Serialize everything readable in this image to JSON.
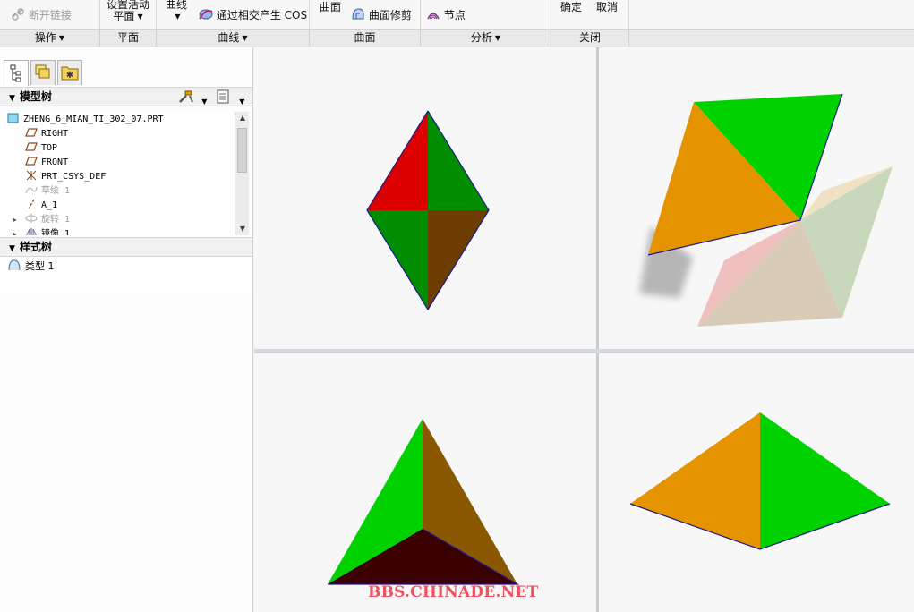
{
  "ribbon": {
    "groups": [
      {
        "label": "操作",
        "has_menu": true
      },
      {
        "label": "平面",
        "has_menu": false
      },
      {
        "label": "曲线",
        "has_menu": true
      },
      {
        "label": "曲面",
        "has_menu": false
      },
      {
        "label": "分析",
        "has_menu": true
      },
      {
        "label": "关闭",
        "has_menu": false
      }
    ],
    "disconnect_link": "断开链接",
    "set_active_plane_line1": "设置活动",
    "set_active_plane_line2": "平面",
    "curve": "曲线",
    "intersect_cos": "通过相交产生 COS",
    "surface": "曲面",
    "surface_trim": "曲面修剪",
    "node": "节点",
    "ok": "确定",
    "cancel": "取消"
  },
  "left_panel": {
    "model_tree_title": "模型树",
    "style_tree_title": "样式树",
    "model_tree_items": [
      {
        "label": "ZHENG_6_MIAN_TI_302_07.PRT",
        "icon": "part-icon",
        "dim": false,
        "expandable": false
      },
      {
        "label": "RIGHT",
        "icon": "datum-plane-icon",
        "dim": false,
        "expandable": false
      },
      {
        "label": "TOP",
        "icon": "datum-plane-icon",
        "dim": false,
        "expandable": false
      },
      {
        "label": "FRONT",
        "icon": "datum-plane-icon",
        "dim": false,
        "expandable": false
      },
      {
        "label": "PRT_CSYS_DEF",
        "icon": "csys-icon",
        "dim": false,
        "expandable": false
      },
      {
        "label": "草绘 1",
        "icon": "sketch-icon",
        "dim": true,
        "expandable": false
      },
      {
        "label": "A_1",
        "icon": "axis-icon",
        "dim": false,
        "expandable": false
      },
      {
        "label": "旋转 1",
        "icon": "revolve-icon",
        "dim": true,
        "expandable": true
      },
      {
        "label": "镜像 1",
        "icon": "mirror-icon",
        "dim": false,
        "expandable": true
      }
    ],
    "style_tree_items": [
      {
        "label": "类型 1",
        "icon": "style-type-icon"
      }
    ]
  },
  "watermark": "BBS.CHINADE.NET",
  "colors": {
    "red": "#dc0000",
    "dark_green": "#008e00",
    "bright_green": "#00d200",
    "brown": "#6c3c00",
    "orange": "#e59400",
    "ochre": "#8a5800",
    "maroon": "#3a0000",
    "edge": "#1a1a8c"
  }
}
